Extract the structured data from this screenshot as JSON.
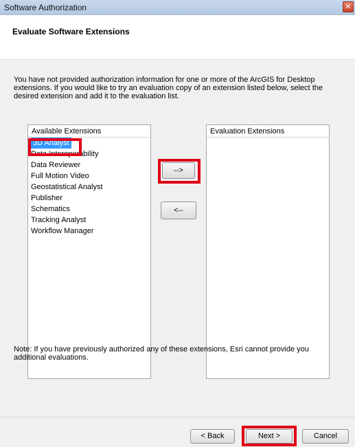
{
  "window": {
    "title": "Software Authorization",
    "close_glyph": "✕"
  },
  "header": {
    "heading": "Evaluate Software Extensions"
  },
  "intro": {
    "text": "You have not provided authorization information for one or more of the ArcGIS for Desktop extensions.  If you would like to try an evaluation copy of an extension listed below, select the desired extension and add it to the evaluation list."
  },
  "available": {
    "header": "Available Extensions",
    "items": [
      "3D Analyst",
      "Data Interoperability",
      "Data Reviewer",
      "Full Motion Video",
      "Geostatistical Analyst",
      "Publisher",
      "Schematics",
      "Tracking Analyst",
      "Workflow Manager"
    ],
    "selected": "3D Analyst"
  },
  "evaluation": {
    "header": "Evaluation Extensions",
    "items": []
  },
  "buttons": {
    "add": "-->",
    "remove": "<--",
    "back": "< Back",
    "next": "Next >",
    "cancel": "Cancel"
  },
  "note": {
    "text": "Note:  If you have previously authorized any of these extensions, Esri cannot provide you additional evaluations."
  },
  "colors": {
    "highlight": "#e00018",
    "selection": "#3399ff"
  }
}
